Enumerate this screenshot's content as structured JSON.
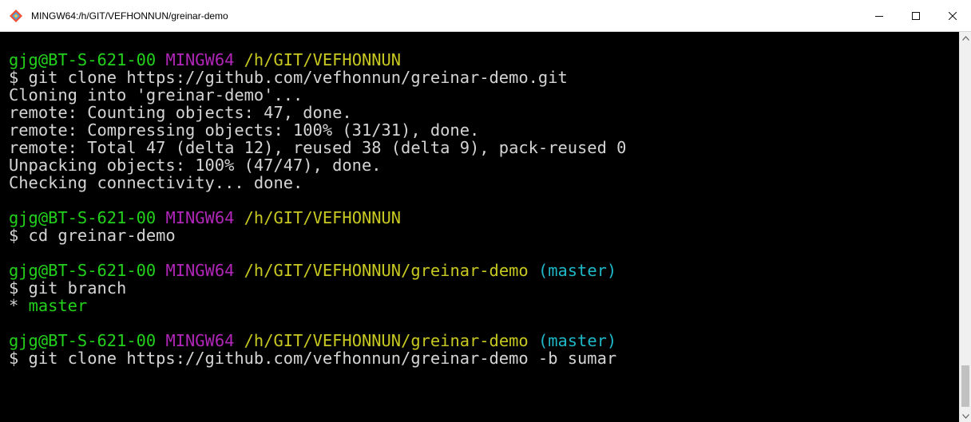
{
  "window": {
    "title": "MINGW64:/h/GIT/VEFHONNUN/greinar-demo",
    "icon": "git-bash-icon",
    "controls": {
      "minimize": "minimize-icon",
      "maximize": "maximize-icon",
      "close": "close-icon"
    }
  },
  "colors": {
    "background": "#000000",
    "user_host": "#23d11c",
    "shell": "#b026b8",
    "path": "#c8c823",
    "branch": "#1fb8c8",
    "text": "#c0c0c0"
  },
  "terminal": {
    "lines": [
      {
        "user": "gjg@BT-S-621-00",
        "shell": "MINGW64",
        "path": "/h/GIT/VEFHONNUN",
        "branch": ""
      },
      {
        "text": "$ git clone https://github.com/vefhonnun/greinar-demo.git"
      },
      {
        "text": "Cloning into 'greinar-demo'..."
      },
      {
        "text": "remote: Counting objects: 47, done."
      },
      {
        "text": "remote: Compressing objects: 100% (31/31), done."
      },
      {
        "text": "remote: Total 47 (delta 12), reused 38 (delta 9), pack-reused 0"
      },
      {
        "text": "Unpacking objects: 100% (47/47), done."
      },
      {
        "text": "Checking connectivity... done."
      },
      {
        "text": ""
      },
      {
        "user": "gjg@BT-S-621-00",
        "shell": "MINGW64",
        "path": "/h/GIT/VEFHONNUN",
        "branch": ""
      },
      {
        "text": "$ cd greinar-demo"
      },
      {
        "text": ""
      },
      {
        "user": "gjg@BT-S-621-00",
        "shell": "MINGW64",
        "path": "/h/GIT/VEFHONNUN/greinar-demo",
        "branch": "(master)"
      },
      {
        "text": "$ git branch"
      },
      {
        "marker": "*",
        "current_branch": "master"
      },
      {
        "text": ""
      },
      {
        "user": "gjg@BT-S-621-00",
        "shell": "MINGW64",
        "path": "/h/GIT/VEFHONNUN/greinar-demo",
        "branch": "(master)"
      },
      {
        "text": "$ git clone https://github.com/vefhonnun/greinar-demo -b sumar"
      }
    ]
  }
}
